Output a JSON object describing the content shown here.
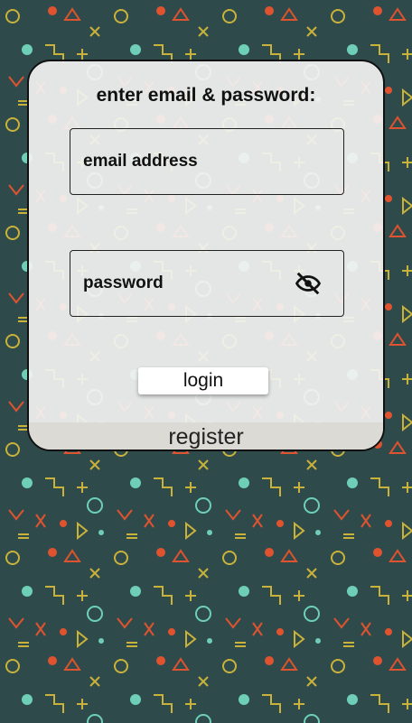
{
  "login_card": {
    "heading": "enter email & password:",
    "email_placeholder": "email address",
    "password_placeholder": "password",
    "password_toggle_icon": "eye-slash-icon",
    "login_label": "login",
    "register_label": "register"
  },
  "colors": {
    "background": "#2f4a4a",
    "card": "#f2f2f2",
    "register_bar": "#dcdad4",
    "pattern_red": "#e0532f",
    "pattern_yellow": "#c9b23a",
    "pattern_teal": "#6fcfb6"
  }
}
